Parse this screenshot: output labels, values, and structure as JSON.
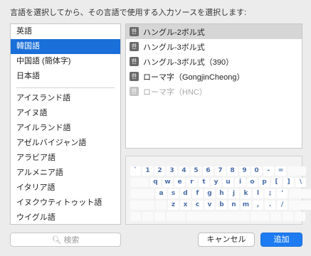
{
  "instruction": "言語を選択してから、その言語で使用する入力ソースを選択します:",
  "languages": [
    {
      "label": "英語",
      "selected": false
    },
    {
      "label": "韓国語",
      "selected": true
    },
    {
      "label": "中国語 (簡体字)",
      "selected": false
    },
    {
      "label": "日本語",
      "selected": false
    },
    {
      "label": "アイスランド語",
      "selected": false
    },
    {
      "label": "アイヌ語",
      "selected": false
    },
    {
      "label": "アイルランド語",
      "selected": false
    },
    {
      "label": "アゼルバイジャン語",
      "selected": false
    },
    {
      "label": "アラビア語",
      "selected": false
    },
    {
      "label": "アルメニア語",
      "selected": false
    },
    {
      "label": "イタリア語",
      "selected": false
    },
    {
      "label": "イヌクウティトゥット語",
      "selected": false
    },
    {
      "label": "ウイグル語",
      "selected": false
    }
  ],
  "input_sources": [
    {
      "label": "ハングル-2ボル式",
      "icon": "hangul-icon",
      "glyph": "한",
      "selected": true,
      "enabled": true
    },
    {
      "label": "ハングル-3ボル式",
      "icon": "hangul-icon",
      "glyph": "한",
      "selected": false,
      "enabled": true
    },
    {
      "label": "ハングル-3ボル式（390）",
      "icon": "hangul-icon",
      "glyph": "한",
      "selected": false,
      "enabled": true
    },
    {
      "label": "ローマ字（GongjinCheong）",
      "icon": "hangul-icon",
      "glyph": "한",
      "selected": false,
      "enabled": true
    },
    {
      "label": "ローマ字（HNC）",
      "icon": "hangul-icon",
      "glyph": "한",
      "selected": false,
      "enabled": false
    }
  ],
  "keyboard": {
    "row1": [
      "`",
      "1",
      "2",
      "3",
      "4",
      "5",
      "6",
      "7",
      "8",
      "9",
      "0",
      "-",
      "="
    ],
    "row2": [
      "q",
      "w",
      "e",
      "r",
      "t",
      "y",
      "u",
      "i",
      "o",
      "p",
      "[",
      "]",
      "\\"
    ],
    "row3": [
      "a",
      "s",
      "d",
      "f",
      "g",
      "h",
      "j",
      "k",
      "l",
      ";",
      "'"
    ],
    "row4": [
      "z",
      "x",
      "c",
      "v",
      "b",
      "n",
      "m",
      ",",
      ".",
      "/"
    ]
  },
  "search": {
    "placeholder": "検索",
    "icon": "search-icon"
  },
  "buttons": {
    "cancel": "キャンセル",
    "add": "追加"
  },
  "colors": {
    "selection": "#1a6fd9",
    "primary_button": "#1e7cf2",
    "key_text": "#4b6ea8"
  }
}
